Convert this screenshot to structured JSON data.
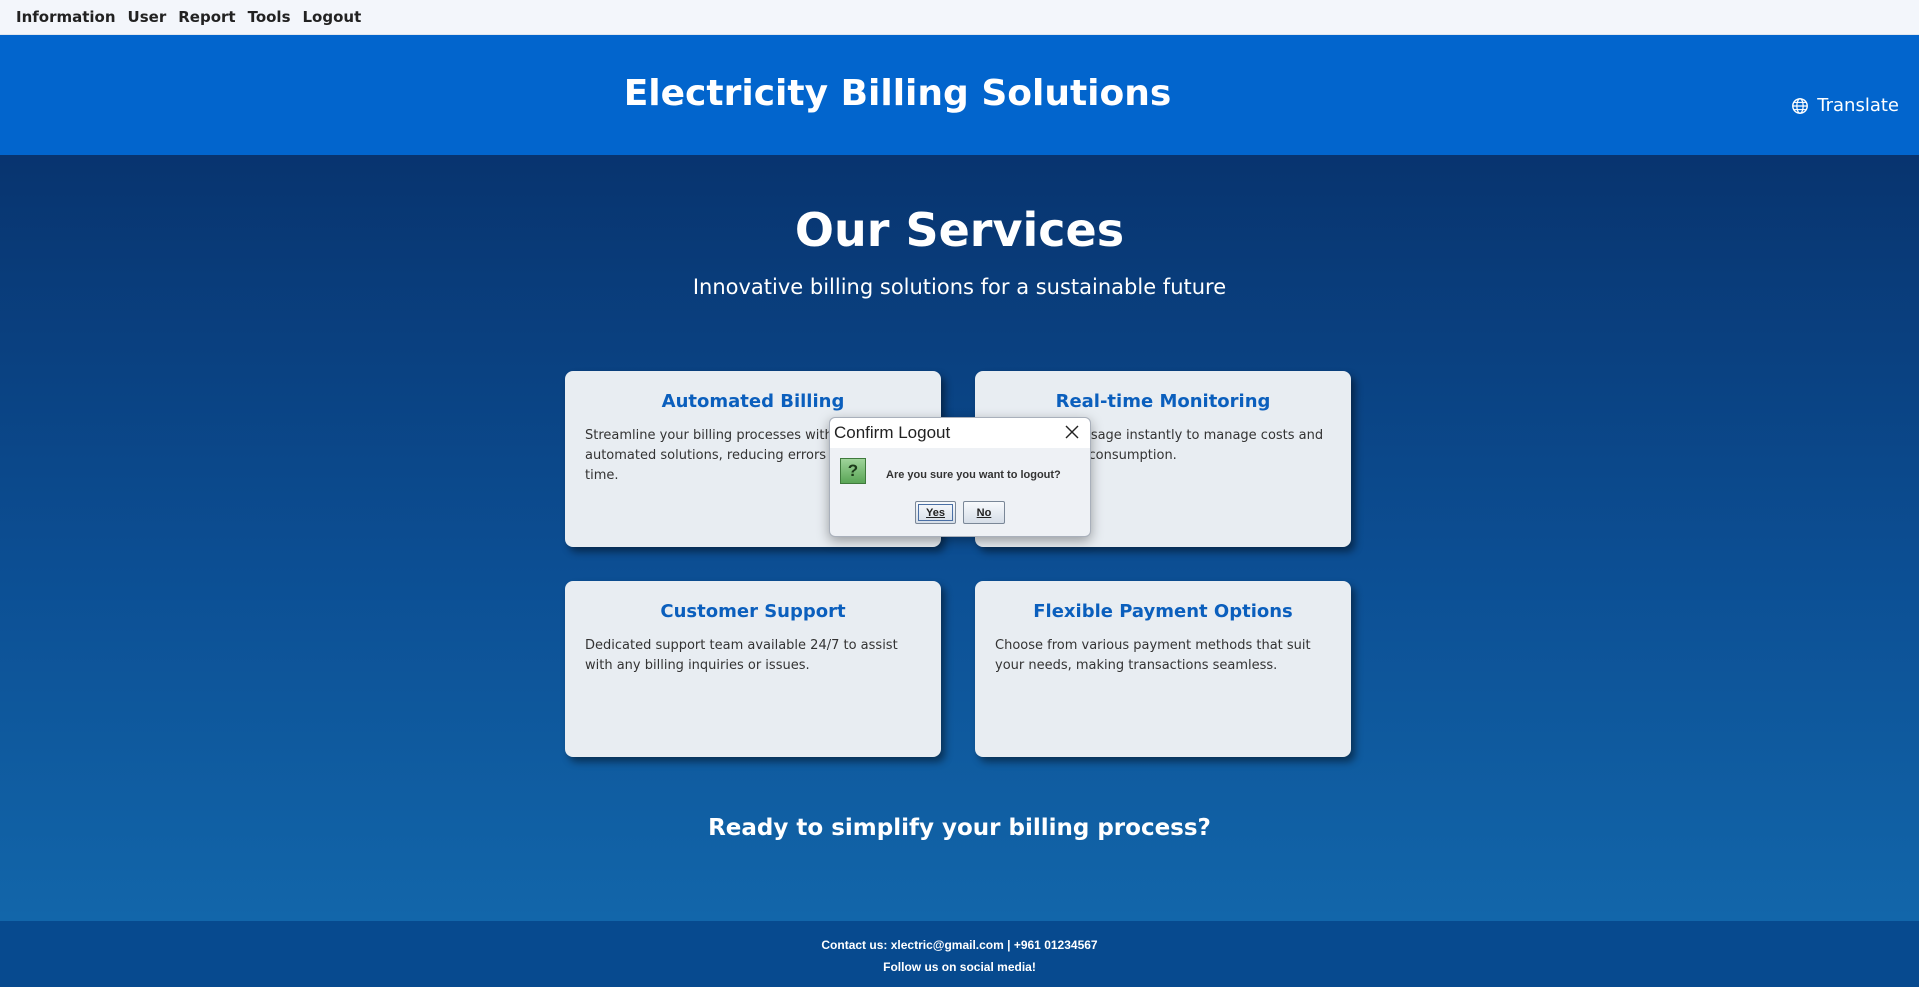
{
  "menubar": {
    "items": [
      "Information",
      "User",
      "Report",
      "Tools",
      "Logout"
    ]
  },
  "header": {
    "title": "Electricity Billing Solutions",
    "translate_label": "Translate"
  },
  "main": {
    "title": "Our Services",
    "subtitle": "Innovative billing solutions for a sustainable future",
    "cards": [
      {
        "title": "Automated Billing",
        "text": "Streamline your billing processes with our automated solutions, reducing errors and saving time."
      },
      {
        "title": "Real-time Monitoring",
        "text": "Track energy usage instantly to manage costs and optimize your consumption."
      },
      {
        "title": "Customer Support",
        "text": "Dedicated support team available 24/7 to assist with any billing inquiries or issues."
      },
      {
        "title": "Flexible Payment Options",
        "text": "Choose from various payment methods that suit your needs, making transactions seamless."
      }
    ],
    "cta": "Ready to simplify your billing process?"
  },
  "footer": {
    "contact": "Contact us: xlectric@gmail.com | +961 01234567",
    "social": "Follow us on social media!"
  },
  "dialog": {
    "title": "Confirm Logout",
    "message": "Are you sure you want to logout?",
    "yes_label": "Yes",
    "no_label": "No",
    "icon_glyph": "?"
  },
  "colors": {
    "header_bg": "#0265cd",
    "card_title": "#0b5fbd",
    "footer_bg": "#074a8f"
  }
}
